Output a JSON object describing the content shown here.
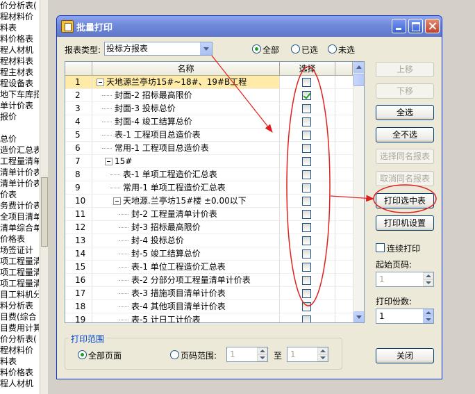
{
  "background_list": [
    "价分析表(",
    "程材料价",
    "料表",
    "料价格表",
    "程人材机",
    "程材料表",
    "程主材表",
    "程设备表",
    "地下车库招",
    "单计价表",
    "报价",
    "",
    "总价",
    "造价汇总表",
    "工程量清单",
    "清单计价表",
    "清单计价表",
    "价表",
    "务费计价表",
    "全项目清单",
    "清单综合单",
    "价格表",
    "场签证计",
    "项工程量清",
    "项工程量清",
    "项工程量清",
    "目工料机分",
    "料分析表",
    "目费(综合",
    "目费用计算",
    "价分析表(",
    "程材料价",
    "料表",
    "料价格表",
    "程人材机"
  ],
  "dialog": {
    "title": "批量打印",
    "report_type_label": "报表类型:",
    "report_type_value": "投标方报表",
    "filter_options": [
      "全部",
      "已选",
      "未选"
    ],
    "filter_selected": "全部"
  },
  "grid": {
    "headers": {
      "name": "名称",
      "select": "选择"
    },
    "rows": [
      {
        "num": "1",
        "name": "天地源兰亭坊15#~18#、19#B工程",
        "level": 0,
        "expander": true,
        "checked": false,
        "selected": true
      },
      {
        "num": "2",
        "name": "封面-2 招标最高限价",
        "level": 1,
        "expander": false,
        "checked": true
      },
      {
        "num": "3",
        "name": "封面-3 投标总价",
        "level": 1,
        "expander": false,
        "checked": false
      },
      {
        "num": "4",
        "name": "封面-4 竣工结算总价",
        "level": 1,
        "expander": false,
        "checked": false
      },
      {
        "num": "5",
        "name": "表-1 工程项目总造价表",
        "level": 1,
        "expander": false,
        "checked": false
      },
      {
        "num": "6",
        "name": "常用-1 工程项目总造价表",
        "level": 1,
        "expander": false,
        "checked": false
      },
      {
        "num": "7",
        "name": "15#",
        "level": 1,
        "expander": true,
        "checked": false
      },
      {
        "num": "8",
        "name": "表-1 单项工程造价汇总表",
        "level": 2,
        "expander": false,
        "checked": false
      },
      {
        "num": "9",
        "name": "常用-1 单项工程造价汇总表",
        "level": 2,
        "expander": false,
        "checked": false
      },
      {
        "num": "10",
        "name": "天地源.兰亭坊15#楼 ±0.00以下",
        "level": 2,
        "expander": true,
        "checked": false
      },
      {
        "num": "11",
        "name": "封-2 工程量清单计价表",
        "level": 3,
        "expander": false,
        "checked": false
      },
      {
        "num": "12",
        "name": "封-3 招标最高限价",
        "level": 3,
        "expander": false,
        "checked": false
      },
      {
        "num": "13",
        "name": "封-4 投标总价",
        "level": 3,
        "expander": false,
        "checked": false
      },
      {
        "num": "14",
        "name": "封-5 竣工结算总价",
        "level": 3,
        "expander": false,
        "checked": false
      },
      {
        "num": "15",
        "name": "表-1 单位工程造价汇总表",
        "level": 3,
        "expander": false,
        "checked": false
      },
      {
        "num": "16",
        "name": "表-2 分部分项工程量清单计价表",
        "level": 3,
        "expander": false,
        "checked": false
      },
      {
        "num": "17",
        "name": "表-3 措施项目清单计价表",
        "level": 3,
        "expander": false,
        "checked": false
      },
      {
        "num": "18",
        "name": "表-4 其他项目清单计价表",
        "level": 3,
        "expander": false,
        "checked": false
      },
      {
        "num": "19",
        "name": "表-5 计日工计价表",
        "level": 3,
        "expander": false,
        "checked": false
      }
    ]
  },
  "buttons": {
    "move_up": "上移",
    "move_down": "下移",
    "select_all": "全选",
    "select_none": "全不选",
    "select_same": "选择同名报表",
    "cancel_same": "取消同名报表",
    "print_selected": "打印选中表",
    "print_settings": "打印机设置",
    "close": "关闭"
  },
  "continuous_print": {
    "label": "连续打印",
    "checked": false
  },
  "start_page": {
    "label": "起始页码:",
    "value": "1"
  },
  "copies": {
    "label": "打印份数:",
    "value": "1"
  },
  "print_range": {
    "title": "打印范围",
    "all_pages": "全部页面",
    "page_range": "页码范围:",
    "from": "1",
    "to_label": "至",
    "to": "1",
    "selected": "全部页面"
  },
  "annotation_color": "#e0201e"
}
